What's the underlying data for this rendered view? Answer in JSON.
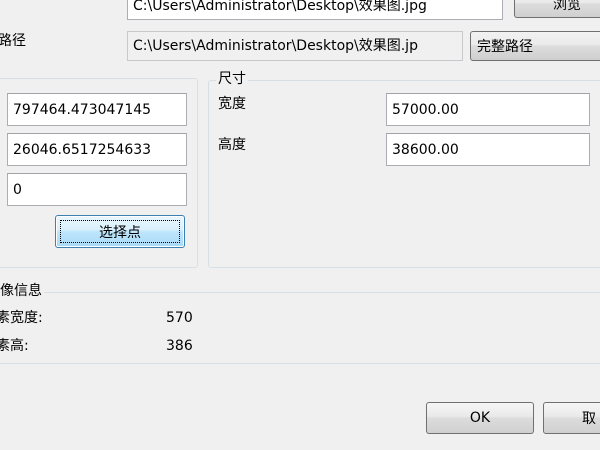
{
  "file": {
    "path_value": "C:\\Users\\Administrator\\Desktop\\效果图.jpg",
    "browse_label": "浏览"
  },
  "path_row": {
    "label": "路径",
    "value": "C:\\Users\\Administrator\\Desktop\\效果图.jp",
    "mode_selected": "完整路径"
  },
  "point": {
    "x_value": "797464.473047145",
    "y_value": "26046.6517254633",
    "z_value": "0",
    "select_button": "选择点"
  },
  "size": {
    "title": "尺寸",
    "width_label": "宽度",
    "width_value": "57000.00",
    "height_label": "高度",
    "height_value": "38600.00"
  },
  "image_info": {
    "title": "像信息",
    "width_label": "素宽度:",
    "width_value": "570",
    "height_label": "素高:",
    "height_value": "386"
  },
  "footer": {
    "ok_label": "OK",
    "cancel_label": "取"
  }
}
